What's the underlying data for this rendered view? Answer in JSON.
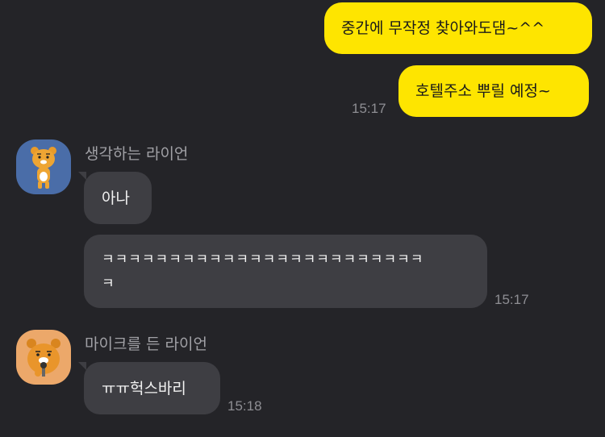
{
  "messages_out": {
    "msg1": "중간에 무작정 찾아와도댐~^^",
    "msg2": "호텔주소 뿌릴 예정~",
    "time": "15:17"
  },
  "group1": {
    "sender": "생각하는 라이언",
    "msg1": "아나",
    "msg2_line1": "ㅋㅋㅋㅋㅋㅋㅋㅋㅋㅋㅋㅋㅋㅋㅋㅋㅋㅋㅋㅋㅋㅋㅋㅋ",
    "msg2_line2": "ㅋ",
    "time": "15:17",
    "avatar_icon": "thinking-ryan-avatar",
    "avatar_bg": "#4a6da8"
  },
  "group2": {
    "sender": "마이크를 든 라이언",
    "msg1": "ㅠㅠ헉스바리",
    "time": "15:18",
    "avatar_icon": "mic-ryan-avatar",
    "avatar_bg": "#eca86a"
  },
  "colors": {
    "background": "#242428",
    "outgoing_bubble": "#fee500",
    "incoming_bubble": "#3e3e43"
  }
}
